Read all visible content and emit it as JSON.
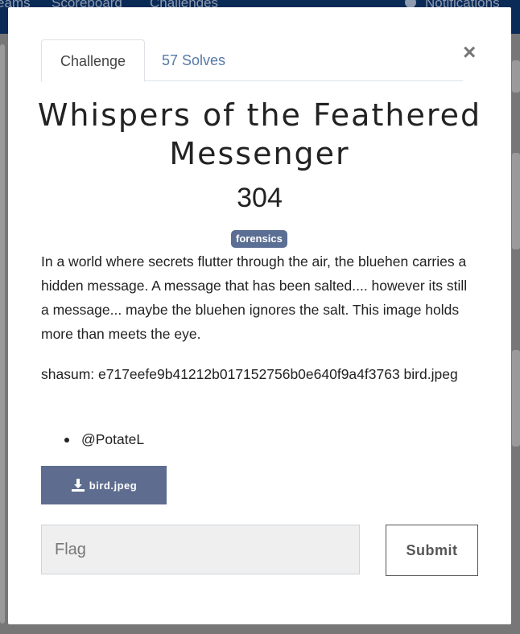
{
  "background": {
    "nav_items": [
      "eams",
      "Scoreboard",
      "Challenges"
    ],
    "notifications": "Notifications"
  },
  "tabs": {
    "challenge": "Challenge",
    "solves": "57 Solves"
  },
  "close_symbol": "×",
  "challenge": {
    "title": "Whispers of the Feathered Messenger",
    "points": "304",
    "tag": "forensics",
    "description": "In a world where secrets flutter through the air, the bluehen carries a hidden message. A message that has been salted.... however its still a message... maybe the bluehen ignores the salt. This image holds more than meets the eye.",
    "shasum": "shasum: e717eefe9b41212b017152756b0e640f9a4f3763 bird.jpeg",
    "author": "@PotateL",
    "file_label": "bird.jpeg"
  },
  "form": {
    "flag_placeholder": "Flag",
    "submit_label": "Submit"
  },
  "colors": {
    "tag_bg": "#5b6e93",
    "file_button_bg": "#5e6d8f",
    "solves_link": "#5579a8",
    "navbar": "#0b2b57"
  },
  "icons": {
    "file": "download-icon",
    "close": "close-icon",
    "notifications": "bell-icon"
  }
}
